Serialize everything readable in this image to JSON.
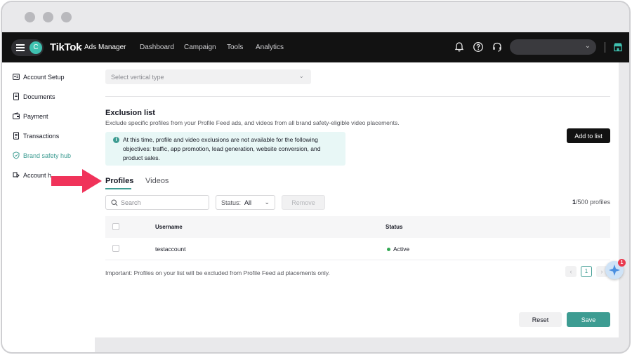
{
  "colors": {
    "accent": "#3d9c92",
    "topbar": "#121212",
    "arrow": "#f0335a",
    "active_status": "#32a852"
  },
  "topbar": {
    "avatar_letter": "C",
    "brand": "TikTok",
    "brand_sub": ": Ads Manager",
    "nav": [
      "Dashboard",
      "Campaign",
      "Tools",
      "Analytics"
    ],
    "icons": [
      "bell-icon",
      "help-icon",
      "headset-icon",
      "store-icon"
    ]
  },
  "sidebar": {
    "items": [
      {
        "label": "Account Setup",
        "icon": "id-card-icon"
      },
      {
        "label": "Documents",
        "icon": "document-icon"
      },
      {
        "label": "Payment",
        "icon": "wallet-icon"
      },
      {
        "label": "Transactions",
        "icon": "receipt-icon"
      },
      {
        "label": "Brand safety hub",
        "icon": "shield-icon",
        "active": true
      },
      {
        "label": "Account h",
        "icon": "health-icon"
      }
    ]
  },
  "main": {
    "vertical_placeholder": "Select vertical type",
    "exclusion_title": "Exclusion list",
    "exclusion_desc": "Exclude specific profiles from your Profile Feed ads, and videos from all brand safety-eligible video placements.",
    "info_text": "At this time, profile and video exclusions are not available for the following objectives: traffic, app promotion, lead generation, website conversion, and product sales.",
    "add_button": "Add to list",
    "tabs": [
      "Profiles",
      "Videos"
    ],
    "search_placeholder": "Search",
    "status_label": "Status:",
    "status_value": "All",
    "remove_button": "Remove",
    "count_current": "1",
    "count_total": "/500 profiles",
    "table": {
      "headers": [
        "Username",
        "Status"
      ],
      "rows": [
        {
          "username": "testaccount",
          "status": "Active"
        }
      ]
    },
    "important": "Important: Profiles on your list will be excluded from Profile Feed ad placements only.",
    "pager": {
      "prev": "‹",
      "current": "1",
      "next": "›"
    },
    "reset_button": "Reset",
    "save_button": "Save",
    "assistant_badge": "1"
  }
}
